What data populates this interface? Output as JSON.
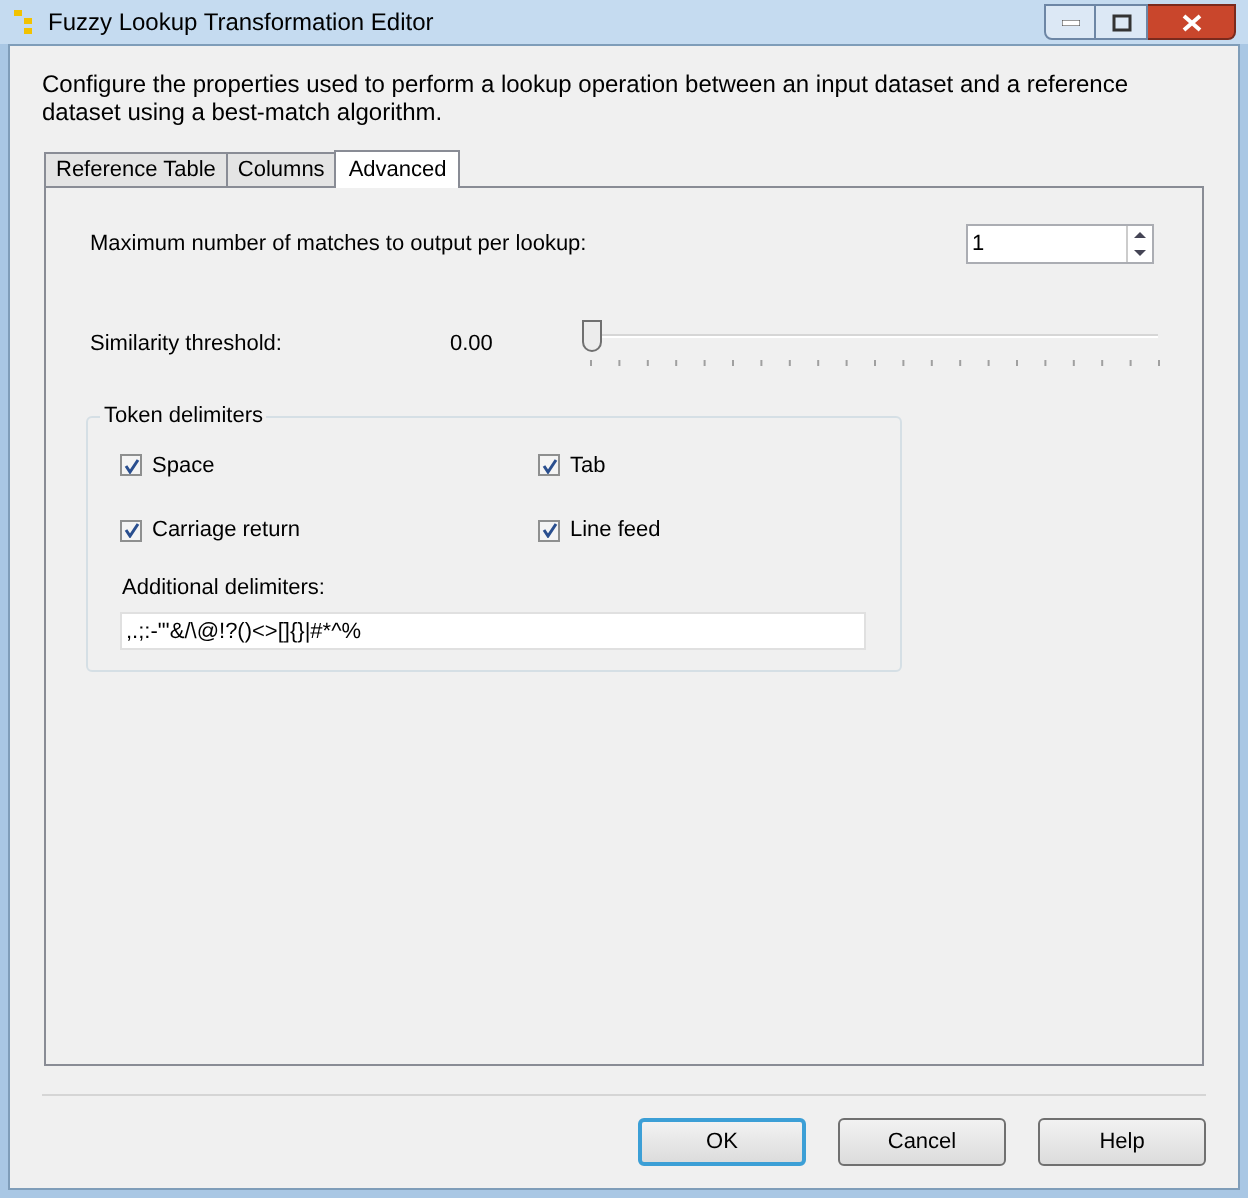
{
  "window": {
    "title": "Fuzzy Lookup Transformation Editor"
  },
  "description": "Configure the properties used to perform a lookup operation between an input dataset and a reference dataset using a best-match algorithm.",
  "tabs": [
    {
      "label": "Reference Table",
      "selected": false
    },
    {
      "label": "Columns",
      "selected": false
    },
    {
      "label": "Advanced",
      "selected": true
    }
  ],
  "max_matches": {
    "label": "Maximum number of matches to output per lookup:",
    "value": "1"
  },
  "similarity": {
    "label": "Similarity threshold:",
    "reading": "0.00",
    "level": 0
  },
  "token_delimiters": {
    "title": "Token delimiters",
    "options": [
      {
        "label": "Space",
        "checked": true
      },
      {
        "label": "Tab",
        "checked": true
      },
      {
        "label": "Carriage return",
        "checked": true
      },
      {
        "label": "Line feed",
        "checked": true
      }
    ],
    "additional_label": "Additional delimiters:",
    "additional_value": ",.;:-\"'&/\\@!?()<>[]{}|#*^%"
  },
  "buttons": [
    {
      "label": "OK",
      "default": true
    },
    {
      "label": "Cancel",
      "default": false
    },
    {
      "label": "Help",
      "default": false
    }
  ]
}
